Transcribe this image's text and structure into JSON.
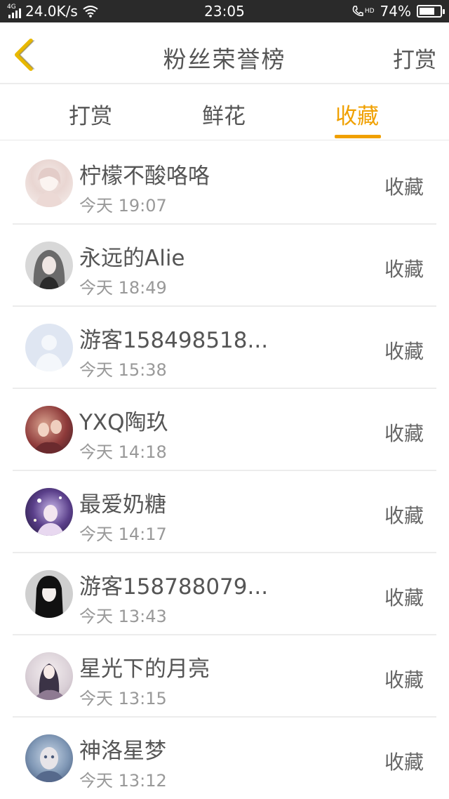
{
  "status_bar": {
    "network": "4G",
    "speed": "24.0K/s",
    "time": "23:05",
    "hd": "HD",
    "battery_percent": "74%",
    "battery_level": 0.74
  },
  "nav": {
    "title": "粉丝荣誉榜",
    "right_action": "打赏",
    "back_icon": "chevron-left-icon",
    "accent_color": "#f0a000"
  },
  "tabs": [
    {
      "label": "打赏",
      "active": false
    },
    {
      "label": "鲜花",
      "active": false
    },
    {
      "label": "收藏",
      "active": true
    }
  ],
  "items": [
    {
      "name": "柠檬不酸咯咯",
      "time": "今天 19:07",
      "action": "收藏"
    },
    {
      "name": "永远的Alie",
      "time": "今天 18:49",
      "action": "收藏"
    },
    {
      "name": "游客158498518...",
      "time": "今天 15:38",
      "action": "收藏"
    },
    {
      "name": "YXQ陶玖",
      "time": "今天 14:18",
      "action": "收藏"
    },
    {
      "name": "最爱奶糖",
      "time": "今天 14:17",
      "action": "收藏"
    },
    {
      "name": "游客158788079...",
      "time": "今天 13:43",
      "action": "收藏"
    },
    {
      "name": "星光下的月亮",
      "time": "今天 13:15",
      "action": "收藏"
    },
    {
      "name": "神洛星梦",
      "time": "今天 13:12",
      "action": "收藏"
    }
  ]
}
